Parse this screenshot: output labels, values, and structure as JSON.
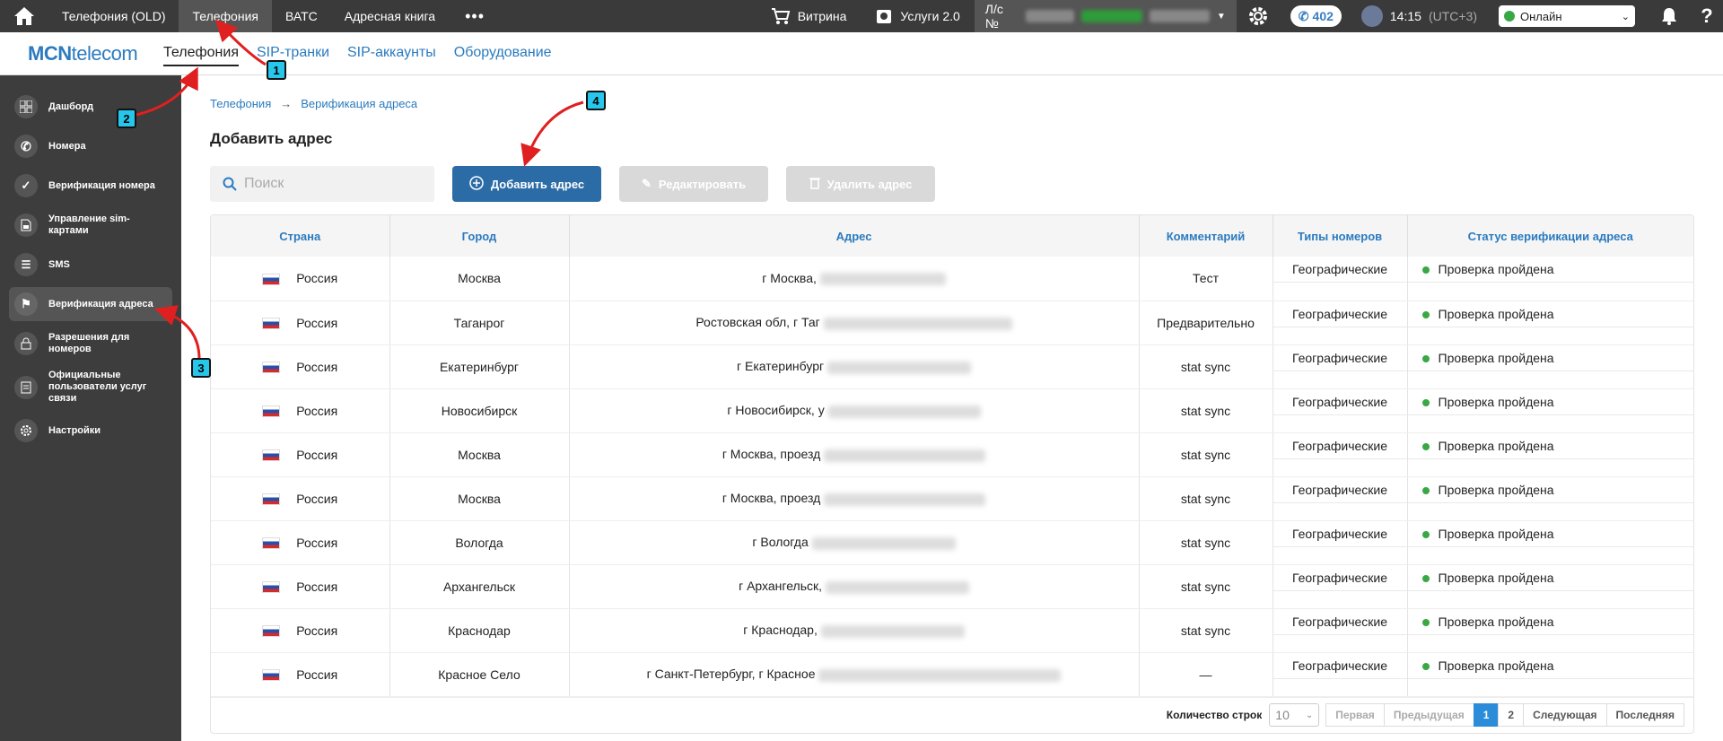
{
  "topbar": {
    "tabs": [
      {
        "label": "Телефония (OLD)"
      },
      {
        "label": "Телефония"
      },
      {
        "label": "ВАТС"
      },
      {
        "label": "Адресная книга"
      }
    ],
    "more": "•••",
    "shop": "Витрина",
    "services": "Услуги 2.0",
    "account_prefix": "Л/с №",
    "phone_count": "402",
    "time": "14:15",
    "timezone": "(UTC+3)",
    "status": "Онлайн",
    "help": "?"
  },
  "header": {
    "logo_bold": "MCN",
    "logo_rest": "telecom",
    "subnav": [
      {
        "label": "Телефония"
      },
      {
        "label": "SIP-транки"
      },
      {
        "label": "SIP-аккаунты"
      },
      {
        "label": "Оборудование"
      }
    ]
  },
  "sidebar": {
    "items": [
      {
        "label": "Дашборд"
      },
      {
        "label": "Номера"
      },
      {
        "label": "Верификация номера"
      },
      {
        "label": "Управление sim-картами"
      },
      {
        "label": "SMS"
      },
      {
        "label": "Верификация адреса"
      },
      {
        "label": "Разрешения для номеров"
      },
      {
        "label": "Официальные пользователи услуг связи"
      },
      {
        "label": "Настройки"
      }
    ]
  },
  "breadcrumb": {
    "root": "Телефония",
    "current": "Верификация адреса"
  },
  "page_title": "Добавить адрес",
  "toolbar": {
    "search_placeholder": "Поиск",
    "add": "Добавить адрес",
    "edit": "Редактировать",
    "delete": "Удалить адрес"
  },
  "table": {
    "columns": [
      "Страна",
      "Город",
      "Адрес",
      "Комментарий",
      "Типы номеров",
      "Статус верификации адреса"
    ],
    "rows": [
      {
        "country": "Россия",
        "city": "Москва",
        "address": "г Москва,",
        "comment": "Тест",
        "type": "Географические",
        "status": "Проверка пройдена"
      },
      {
        "country": "Россия",
        "city": "Таганрог",
        "address": "Ростовская обл, г Таг",
        "comment": "Предварительно",
        "type": "Географические",
        "status": "Проверка пройдена"
      },
      {
        "country": "Россия",
        "city": "Екатеринбург",
        "address": "г Екатеринбург",
        "comment": "stat sync",
        "type": "Географические",
        "status": "Проверка пройдена"
      },
      {
        "country": "Россия",
        "city": "Новосибирск",
        "address": "г Новосибирск, у",
        "comment": "stat sync",
        "type": "Географические",
        "status": "Проверка пройдена"
      },
      {
        "country": "Россия",
        "city": "Москва",
        "address": "г Москва, проезд",
        "comment": "stat sync",
        "type": "Географические",
        "status": "Проверка пройдена"
      },
      {
        "country": "Россия",
        "city": "Москва",
        "address": "г Москва, проезд",
        "comment": "stat sync",
        "type": "Географические",
        "status": "Проверка пройдена"
      },
      {
        "country": "Россия",
        "city": "Вологда",
        "address": "г Вологда",
        "comment": "stat sync",
        "type": "Географические",
        "status": "Проверка пройдена"
      },
      {
        "country": "Россия",
        "city": "Архангельск",
        "address": "г Архангельск,",
        "comment": "stat sync",
        "type": "Географические",
        "status": "Проверка пройдена"
      },
      {
        "country": "Россия",
        "city": "Краснодар",
        "address": "г Краснодар,",
        "comment": "stat sync",
        "type": "Географические",
        "status": "Проверка пройдена"
      },
      {
        "country": "Россия",
        "city": "Красное Село",
        "address": "г Санкт-Петербург, г Красное",
        "comment": "—",
        "type": "Географические",
        "status": "Проверка пройдена"
      }
    ]
  },
  "pagination": {
    "rows_label": "Количество строк",
    "rows_value": "10",
    "first": "Первая",
    "prev": "Предыдущая",
    "page1": "1",
    "page2": "2",
    "next": "Следующая",
    "last": "Последняя"
  },
  "annotations": [
    "1",
    "2",
    "3",
    "4"
  ],
  "colors": {
    "accent": "#2b7bbf",
    "primary_button": "#2b6ca6",
    "sidebar": "#3d3d3d",
    "topbar": "#3a3a3a",
    "annotation": "#27c7ec",
    "arrow": "#e02020",
    "ok": "#3aa745"
  }
}
